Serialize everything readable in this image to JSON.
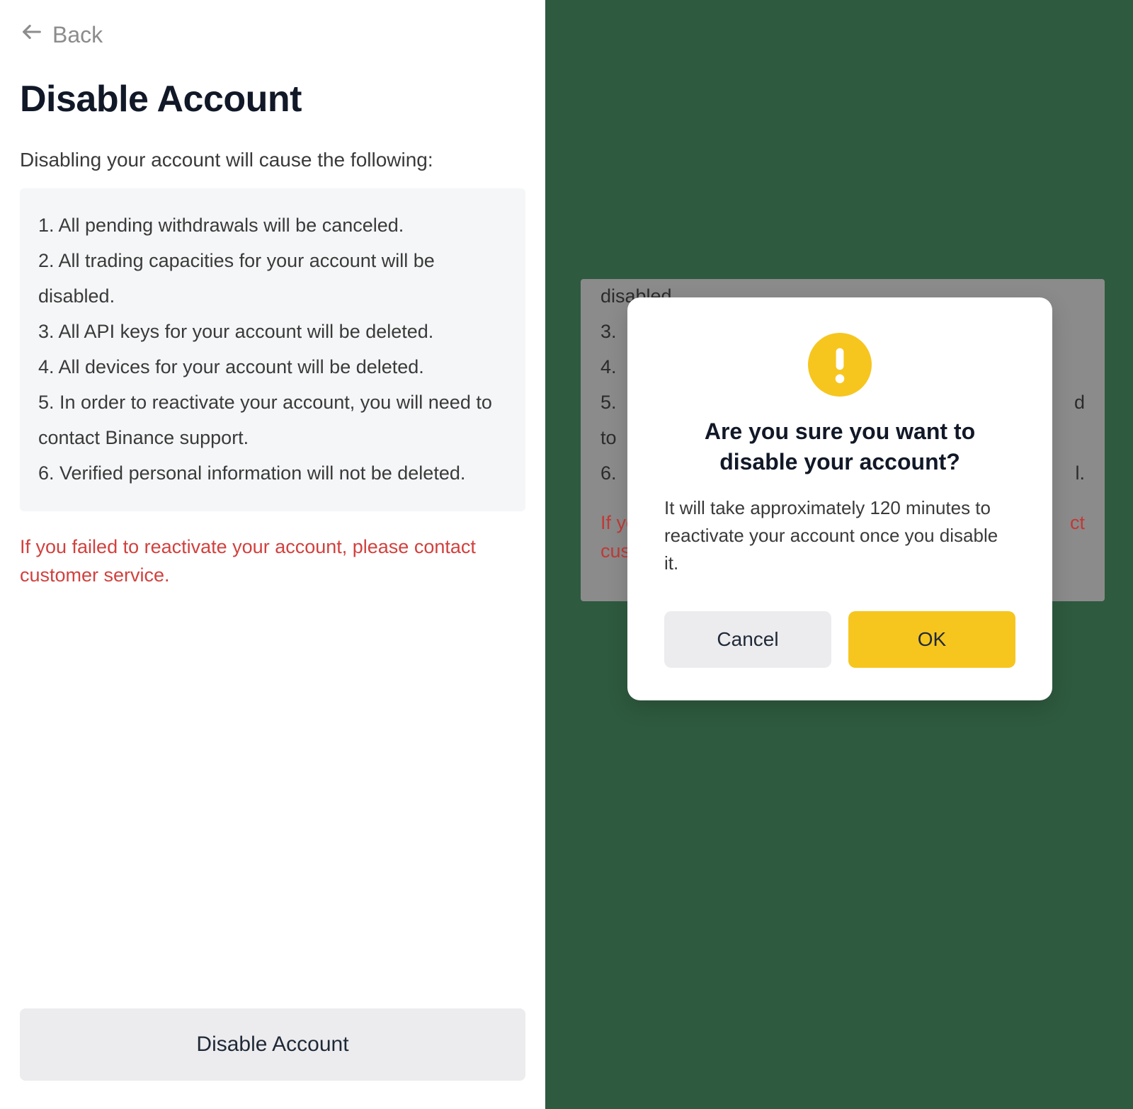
{
  "back_label": "Back",
  "page_title": "Disable Account",
  "intro": "Disabling your account will cause the following:",
  "effects": {
    "e1": "1. All pending withdrawals will be canceled.",
    "e2": "2. All trading capacities for your account will be disabled.",
    "e3": "3. All API keys for your account will be deleted.",
    "e4": "4. All devices for your account will be deleted.",
    "e5": "5. In order to reactivate your account, you will need to contact Binance support.",
    "e6": "6. Verified personal information will not be deleted."
  },
  "warning": "If you failed to reactivate your account, please contact customer service.",
  "disable_button": "Disable Account",
  "bg": {
    "line_disabled": "disabled.",
    "line_3": "3.",
    "line_4": "4.",
    "line_5a": "5.",
    "line_5b": "d",
    "line_to": "to",
    "line_6a": "6.",
    "line_6b": "l.",
    "warn_a": "If you",
    "warn_b": "ct",
    "warn_c": "custo"
  },
  "modal": {
    "title": "Are you sure you want to disable your account?",
    "body": "It will take approximately 120 minutes to reactivate your account once you disable it.",
    "cancel": "Cancel",
    "ok": "OK"
  },
  "colors": {
    "accent_yellow": "#f6c61f",
    "danger_red": "#d1413e",
    "page_bg_green": "#2e5a3f"
  }
}
